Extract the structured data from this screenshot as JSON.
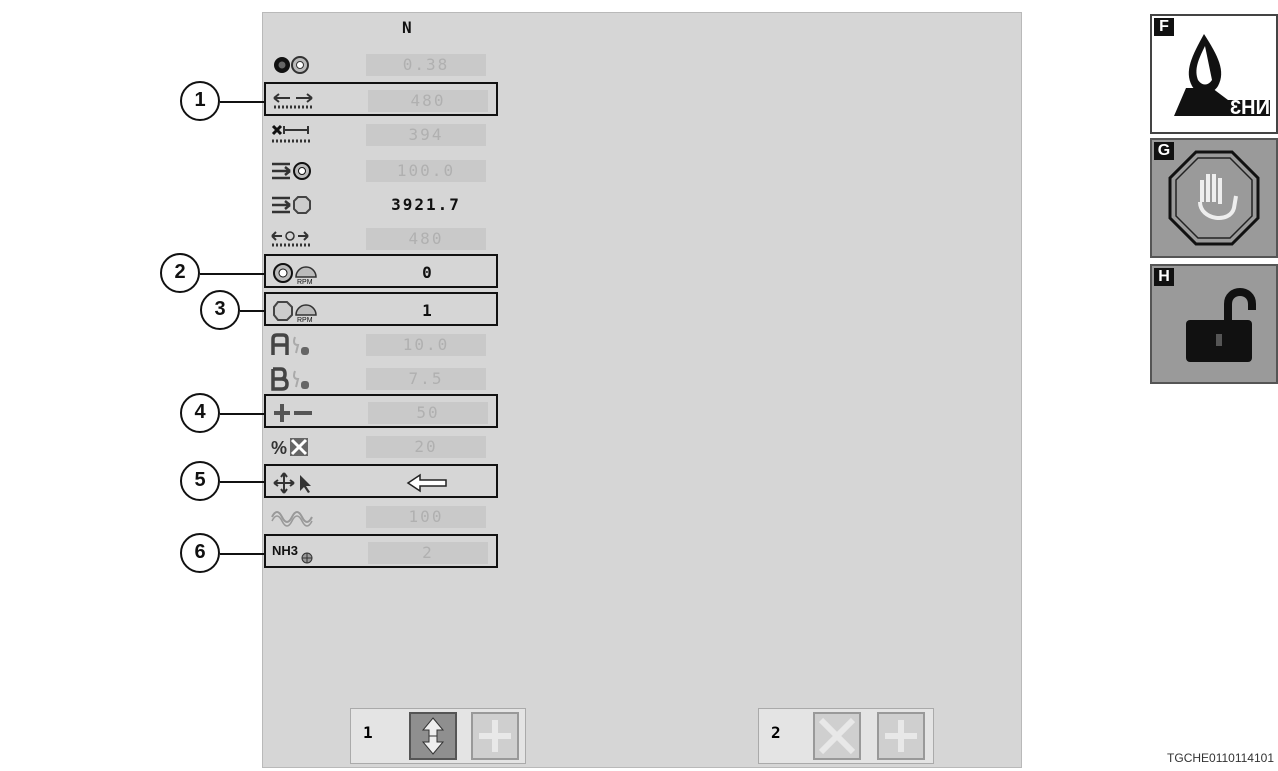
{
  "column_header": "N",
  "rows": [
    {
      "icon": "rate-icon",
      "value": "0.38",
      "style": "dim"
    },
    {
      "icon": "width-icon",
      "value": "480",
      "style": "dim"
    },
    {
      "icon": "excluded-width-icon",
      "value": "394",
      "style": "dim"
    },
    {
      "icon": "target-rate-icon",
      "value": "100.0",
      "style": "dim"
    },
    {
      "icon": "applied-total-icon",
      "value": "3921.7",
      "style": "bright"
    },
    {
      "icon": "section-width-icon",
      "value": "480",
      "style": "dim"
    },
    {
      "icon": "section-rpm-on-icon",
      "value": "0",
      "style": "bright"
    },
    {
      "icon": "section-rpm-off-icon",
      "value": "1",
      "style": "bright"
    },
    {
      "icon": "channel-a-icon",
      "value": "10.0",
      "style": "dim"
    },
    {
      "icon": "channel-b-icon",
      "value": "7.5",
      "style": "dim"
    },
    {
      "icon": "plus-minus-icon",
      "value": "50",
      "style": "dim"
    },
    {
      "icon": "percent-x-icon",
      "value": "20",
      "style": "dim"
    },
    {
      "icon": "move-pointer-icon",
      "value": "arrow-left",
      "style": "bright"
    },
    {
      "icon": "wave-icon",
      "value": "100",
      "style": "dim"
    },
    {
      "icon": "nh3-icon",
      "value": "2",
      "style": "dim"
    }
  ],
  "nh3_icon_label": "NH3",
  "callouts": [
    "1",
    "2",
    "3",
    "4",
    "5",
    "6"
  ],
  "side_buttons": [
    {
      "letter": "F",
      "icon": "nh3-tank-icon",
      "label": "NH3"
    },
    {
      "letter": "G",
      "icon": "stop-hand-icon"
    },
    {
      "letter": "H",
      "icon": "unlock-icon"
    }
  ],
  "bottom": [
    {
      "number": "1",
      "icons": [
        "swap-arrows-icon",
        "plus-icon"
      ]
    },
    {
      "number": "2",
      "icons": [
        "x-icon",
        "plus-icon"
      ]
    }
  ],
  "figure_code": "TGCHE0110114101"
}
